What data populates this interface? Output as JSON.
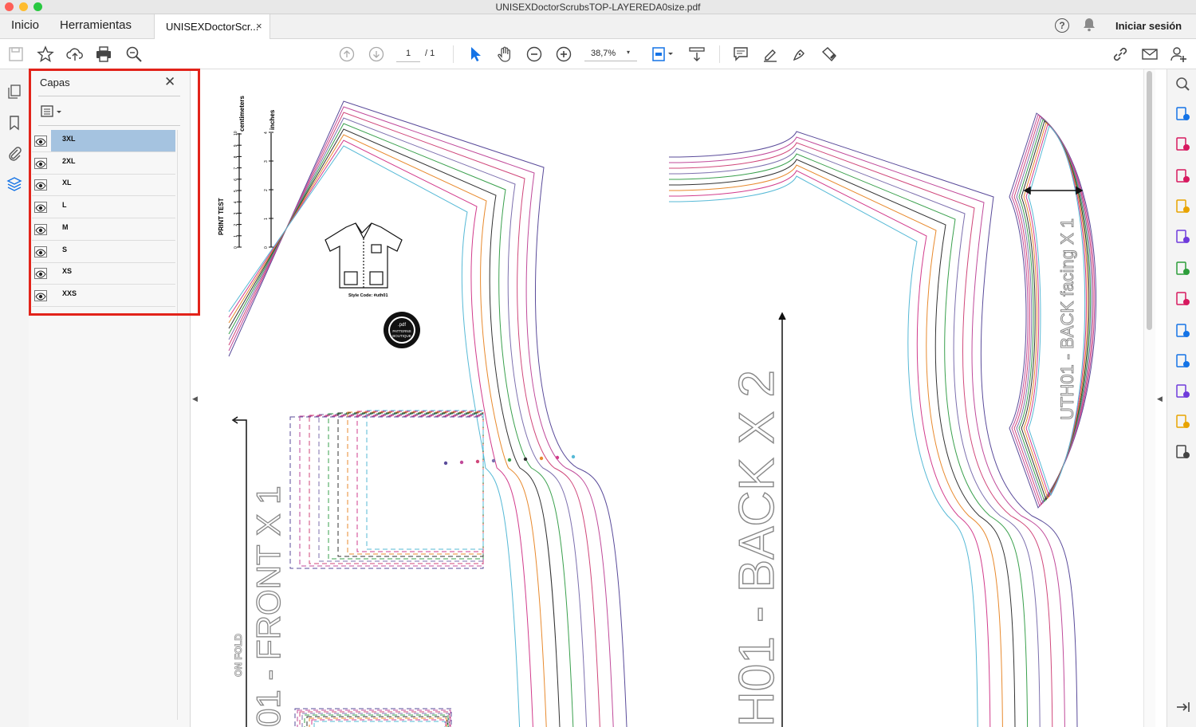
{
  "window": {
    "title": "UNISEXDoctorScrubsTOP-LAYEREDA0size.pdf"
  },
  "tabs": {
    "home": "Inicio",
    "tools": "Herramientas",
    "document": "UNISEXDoctorScr...",
    "close_glyph": "×"
  },
  "header": {
    "help_glyph": "?",
    "bell_glyph": "🔔",
    "signin": "Iniciar sesión"
  },
  "toolbar": {
    "page_current": "1",
    "page_total": "/ 1",
    "zoom": "38,7%",
    "zoom_caret": "▾"
  },
  "layers_panel": {
    "title": "Capas",
    "close_glyph": "✕",
    "selected": "3XL",
    "layers": [
      "3XL",
      "2XL",
      "XL",
      "L",
      "M",
      "S",
      "XS",
      "XXS"
    ]
  },
  "collapse": {
    "left": "◀",
    "right": "◀"
  },
  "document": {
    "print_test": "PRINT TEST",
    "centimeters": "centimeters",
    "inches": "inches",
    "cm_ticks": [
      "0",
      "1",
      "2",
      "3",
      "4",
      "5",
      "6",
      "7",
      "8",
      "9",
      "10"
    ],
    "inch_ticks": [
      "0",
      "1",
      "2",
      "3",
      "4"
    ],
    "style_code": "Style Code: #uth01",
    "logo_lines": [
      ".pdf",
      "PATTERNS",
      "BOUTIQUE"
    ],
    "on_fold": "ON FOLD",
    "front_label": "01 - FRONT X 1",
    "back_label": "H01 - BACK X 2",
    "facing_label": "UTH01 - BACK facing X 1"
  },
  "colors": {
    "highlight": "#e2231a",
    "selected_layer": "#a5c3e0",
    "size_lines": [
      "#5a4b9a",
      "#c04a9a",
      "#d0477a",
      "#7c6fae",
      "#3aa04d",
      "#333333",
      "#e88a2e",
      "#d23c8c",
      "#56b9d6"
    ]
  },
  "icons": {
    "left_rail": [
      "pages-icon",
      "bookmark-icon",
      "attachment-icon",
      "layers-icon"
    ],
    "right_rail": [
      "zoom-tools-icon",
      "export-pdf-icon",
      "organize-pages-icon",
      "create-pdf-icon",
      "comment-icon",
      "combine-icon",
      "compress-icon",
      "fill-sign-icon",
      "protect-icon",
      "send-track-icon",
      "edit-icon",
      "scan-icon",
      "more-tools-icon",
      "collapse-rail-icon"
    ]
  }
}
